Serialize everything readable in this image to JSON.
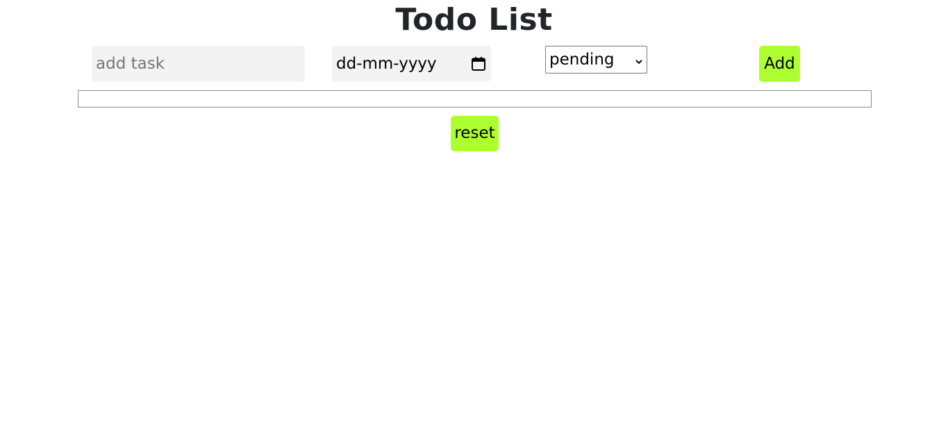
{
  "page": {
    "title": "Todo List"
  },
  "form": {
    "task_input": {
      "value": "",
      "placeholder": "add task"
    },
    "date_input": {
      "value": "dd-mm-yyyy",
      "icon": "calendar-icon"
    },
    "status_select": {
      "selected": "pending",
      "icon": "chevron-down-icon"
    },
    "add_label": "Add"
  },
  "list": {
    "items": []
  },
  "actions": {
    "reset_label": "reset"
  },
  "colors": {
    "accent": "#adff2f",
    "input_background": "#f3f3f3",
    "title": "#212529",
    "list_border": "#8a8a8a"
  }
}
